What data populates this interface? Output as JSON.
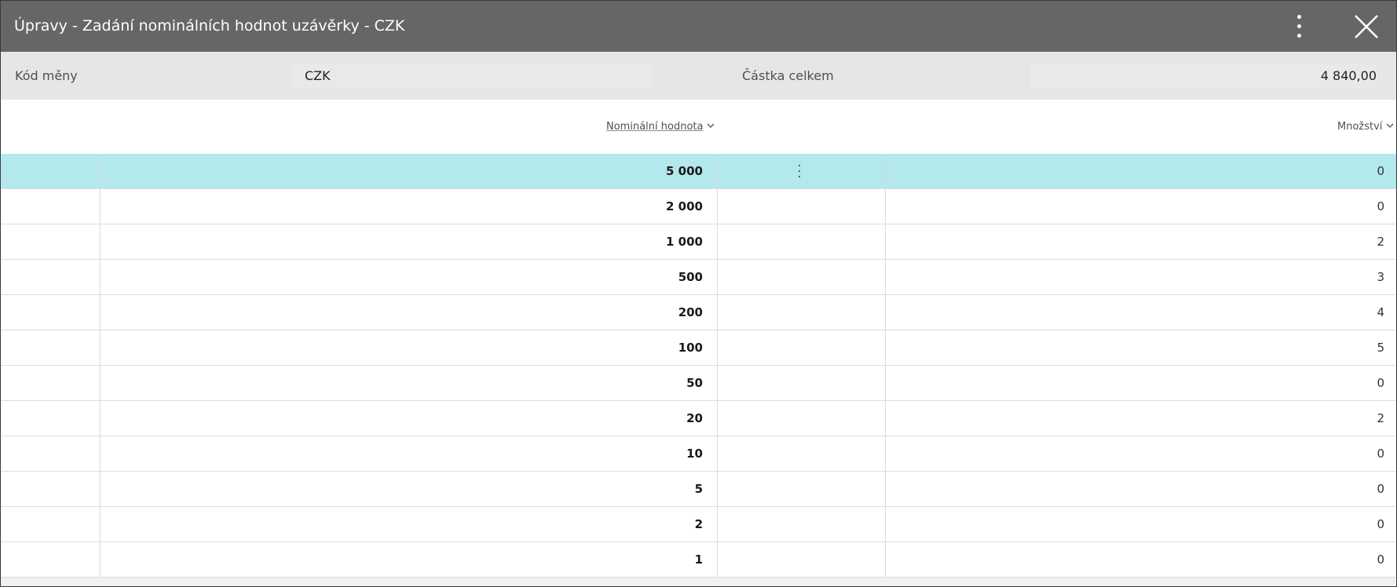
{
  "window": {
    "title": "Úpravy - Zadání nominálních hodnot uzávěrky - CZK",
    "more_icon": "more-vertical-icon",
    "close_icon": "close-icon"
  },
  "header": {
    "currency_code_label": "Kód měny",
    "currency_code_value": "CZK",
    "total_amount_label": "Částka celkem",
    "total_amount_value": "4 840,00"
  },
  "columns": {
    "nominal_value": "Nominální hodnota",
    "quantity": "Množství"
  },
  "rows": [
    {
      "nominal": "5 000",
      "quantity": "0",
      "selected": true
    },
    {
      "nominal": "2 000",
      "quantity": "0"
    },
    {
      "nominal": "1 000",
      "quantity": "2"
    },
    {
      "nominal": "500",
      "quantity": "3"
    },
    {
      "nominal": "200",
      "quantity": "4"
    },
    {
      "nominal": "100",
      "quantity": "5"
    },
    {
      "nominal": "50",
      "quantity": "0"
    },
    {
      "nominal": "20",
      "quantity": "2"
    },
    {
      "nominal": "10",
      "quantity": "0"
    },
    {
      "nominal": "5",
      "quantity": "0"
    },
    {
      "nominal": "2",
      "quantity": "0"
    },
    {
      "nominal": "1",
      "quantity": "0"
    }
  ],
  "colors": {
    "titlebar": "#666666",
    "summary_bg": "#e6e6e6",
    "selected_row": "#b3e8ec"
  }
}
